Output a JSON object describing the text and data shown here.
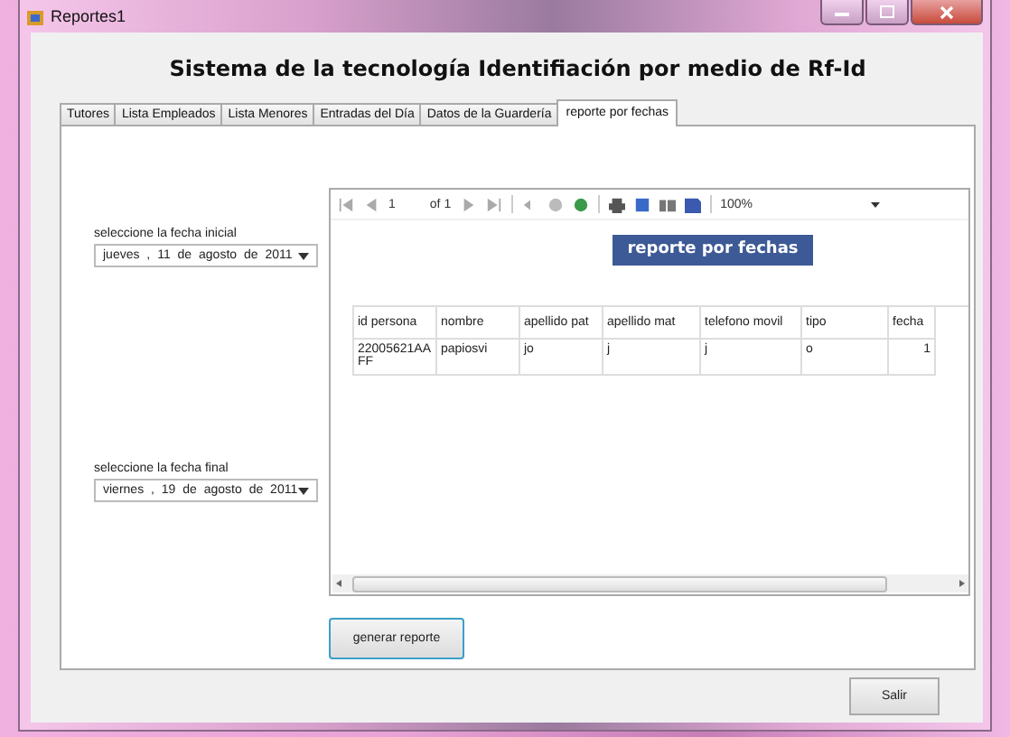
{
  "window": {
    "title": "Reportes1"
  },
  "heading": "Sistema de la tecnología Identifiación por medio de Rf-Id",
  "tabs": [
    {
      "label": "Tutores",
      "selected": false
    },
    {
      "label": "Lista Empleados",
      "selected": false
    },
    {
      "label": "Lista Menores",
      "selected": false
    },
    {
      "label": "Entradas del Día",
      "selected": false
    },
    {
      "label": "Datos de la Guardería",
      "selected": false
    },
    {
      "label": "reporte por fechas",
      "selected": true
    }
  ],
  "date_fields": [
    {
      "label": "seleccione la fecha inicial",
      "value": "jueves , 11 de agosto de 2011"
    },
    {
      "label": "seleccione la fecha final",
      "value": "viernes , 19 de agosto de 2011"
    }
  ],
  "report_viewer": {
    "page": "1",
    "page_count": "of 1",
    "zoom": "100%",
    "report_title": "reporte por fechas",
    "columns": [
      "id persona",
      "nombre",
      "apellido pat",
      "apellido mat",
      "telefono movil",
      "tipo",
      "fecha"
    ],
    "rows": [
      [
        "22005621AAFF",
        "papiosvi",
        "jo",
        "j",
        "j",
        "o",
        "1"
      ]
    ]
  },
  "generate_button": "generar reporte",
  "exit_button": "Salir"
}
